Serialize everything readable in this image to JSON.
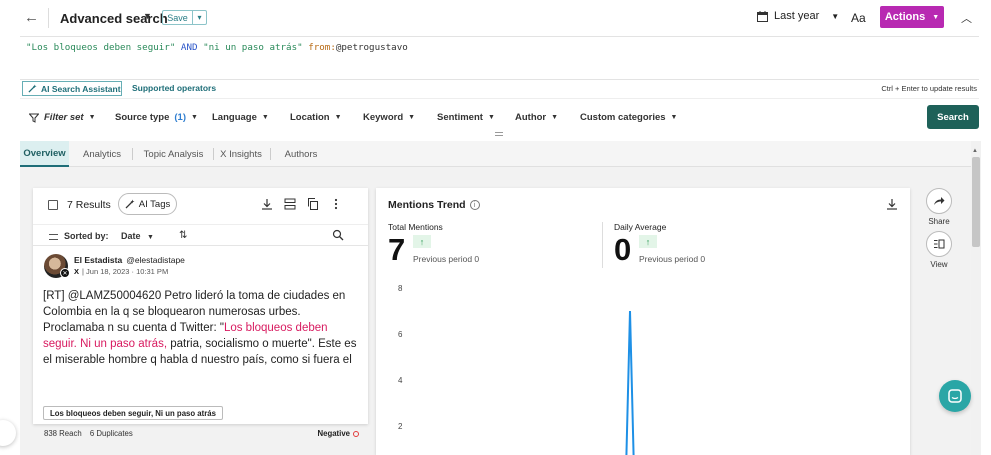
{
  "header": {
    "back_glyph": "←",
    "title": "Advanced search",
    "save_label": "Save",
    "date_range": "Last year",
    "font_size_label": "Aa",
    "actions_label": "Actions"
  },
  "query": {
    "part1": "\"Los bloqueos deben seguir\"",
    "op": "AND",
    "part2": "\"ni un paso atrás\"",
    "from_key": "from:",
    "from_val": "@petrogustavo"
  },
  "assist": {
    "ai_label": "AI Search Assistant",
    "operators_label": "Supported operators",
    "hint": "Ctrl + Enter to update results"
  },
  "filters": {
    "filter_set": "Filter set",
    "source_type": "Source type",
    "source_type_count": "(1)",
    "language": "Language",
    "location": "Location",
    "keyword": "Keyword",
    "sentiment": "Sentiment",
    "author": "Author",
    "custom_categories": "Custom categories",
    "search_label": "Search"
  },
  "tabs": [
    {
      "label": "Overview"
    },
    {
      "label": "Analytics"
    },
    {
      "label": "Topic Analysis"
    },
    {
      "label": "X Insights"
    },
    {
      "label": "Authors"
    }
  ],
  "results": {
    "count_label": "7 Results",
    "ai_tags_label": "AI Tags",
    "sort_label": "Sorted by:",
    "sort_value": "Date"
  },
  "post": {
    "author": "El Estadista",
    "handle": "@elestadistape",
    "source": "X",
    "date": "| Jun 18, 2023 · 10:31 PM",
    "text_before": "[RT] @LAMZ50004620 Petro lideró la toma de ciudades en Colombia en la q se bloquearon numerosas urbes. Proclamaba n su cuenta d Twitter: \"",
    "text_highlight": "Los bloqueos deben seguir. Ni un paso atrás,",
    "text_after": " patria, socialismo o muerte\". Este es el miserable hombre q habla d nuestro país, como si fuera el",
    "tag": "Los bloqueos deben seguir, Ni un paso atrás",
    "reach": "838 Reach",
    "duplicates": "6 Duplicates",
    "sentiment": "Negative"
  },
  "trend": {
    "title": "Mentions Trend",
    "total_label": "Total Mentions",
    "total_value": "7",
    "total_prev": "Previous period 0",
    "daily_label": "Daily Average",
    "daily_value": "0",
    "daily_prev": "Previous period 0"
  },
  "side": {
    "share_label": "Share",
    "view_label": "View"
  },
  "colors": {
    "actions": "#b829b2",
    "search_button": "#1e6159",
    "teal": "#1e6e78",
    "highlight": "#d81b60",
    "chart_line": "#1e90e6"
  },
  "chart_data": {
    "type": "line",
    "y_ticks": [
      "8",
      "6",
      "4",
      "2"
    ],
    "ylim": [
      0,
      8
    ],
    "series": [
      {
        "values": [
          0,
          7,
          0
        ]
      }
    ],
    "grid": false
  }
}
